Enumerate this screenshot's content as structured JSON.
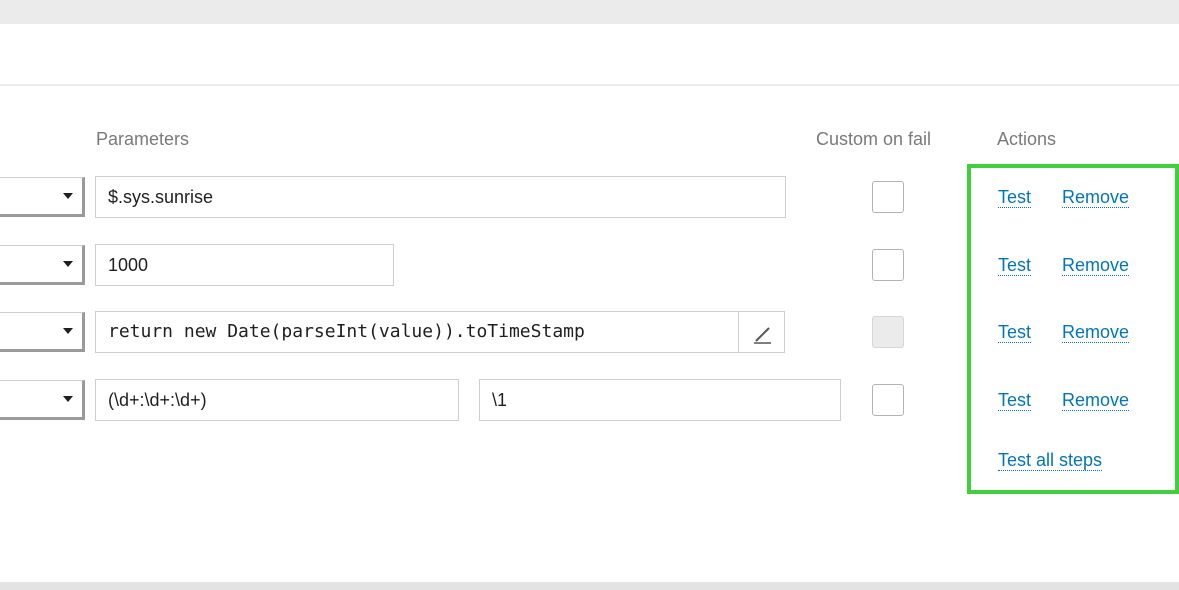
{
  "headers": {
    "parameters": "Parameters",
    "custom_on_fail": "Custom on fail",
    "actions": "Actions"
  },
  "rows": [
    {
      "param1": "$.sys.sunrise",
      "custom_on_fail_checked": false,
      "custom_on_fail_disabled": false
    },
    {
      "param1": "1000",
      "custom_on_fail_checked": false,
      "custom_on_fail_disabled": false
    },
    {
      "param1": "return new Date(parseInt(value)).toTimeStamp",
      "custom_on_fail_checked": false,
      "custom_on_fail_disabled": true
    },
    {
      "param1": "(\\d+:\\d+:\\d+)",
      "param2": "\\1",
      "custom_on_fail_checked": false,
      "custom_on_fail_disabled": false
    }
  ],
  "actions": {
    "test_label": "Test",
    "remove_label": "Remove",
    "test_all_label": "Test all steps"
  },
  "colors": {
    "link": "#0275b8",
    "highlight": "#3fd03c",
    "header_text": "#7a7a7a"
  },
  "icons": {
    "select_caret": "chevron-down-icon",
    "edit": "pencil-icon"
  }
}
